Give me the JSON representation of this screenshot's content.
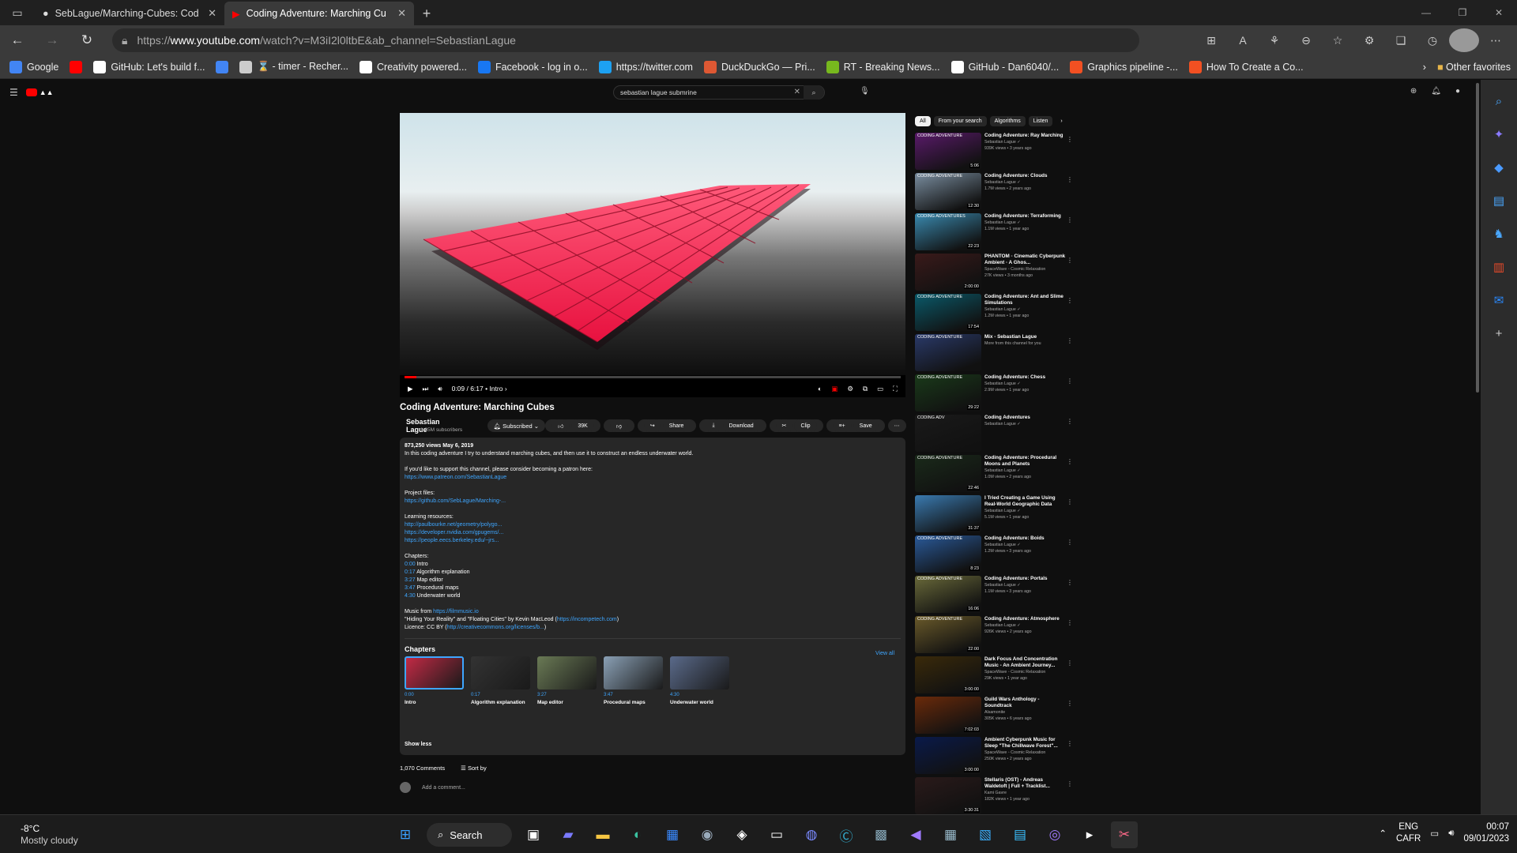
{
  "browser": {
    "tabs": [
      {
        "title": "SebLague/Marching-Cubes: Cod",
        "icon": "github-icon",
        "active": false
      },
      {
        "title": "Coding Adventure: Marching Cu",
        "icon": "youtube-icon",
        "active": true
      }
    ],
    "url_prefix": "https://",
    "url_domain": "www.youtube.com",
    "url_path": "/watch?v=M3iI2l0ltbE&ab_channel=SebastianLague",
    "favorites": [
      {
        "label": "Google",
        "icon": "google-icon",
        "color": "#4285f4"
      },
      {
        "label": "",
        "icon": "youtube-icon",
        "color": "#ff0000"
      },
      {
        "label": "GitHub: Let's build f...",
        "icon": "github-icon",
        "color": "#ffffff"
      },
      {
        "label": "",
        "icon": "google-icon",
        "color": "#4285f4"
      },
      {
        "label": "⌛ - timer - Recher...",
        "icon": "hourglass-icon",
        "color": "#cccccc"
      },
      {
        "label": "Creativity powered...",
        "icon": "patreon-icon",
        "color": "#ffffff"
      },
      {
        "label": "Facebook - log in o...",
        "icon": "facebook-icon",
        "color": "#1877f2"
      },
      {
        "label": "https://twitter.com",
        "icon": "twitter-icon",
        "color": "#1da1f2"
      },
      {
        "label": "DuckDuckGo — Pri...",
        "icon": "duckduckgo-icon",
        "color": "#de5833"
      },
      {
        "label": "RT - Breaking News...",
        "icon": "rt-icon",
        "color": "#77b81e"
      },
      {
        "label": "GitHub - Dan6040/...",
        "icon": "github-icon",
        "color": "#ffffff"
      },
      {
        "label": "Graphics pipeline -...",
        "icon": "microsoft-icon",
        "color": "#f25022"
      },
      {
        "label": "How To Create a Co...",
        "icon": "microsoft-icon",
        "color": "#f25022"
      }
    ],
    "other_favorites": "Other favorites"
  },
  "youtube": {
    "search_query": "sebastian lague submrine",
    "video": {
      "title": "Coding Adventure: Marching Cubes",
      "time": "0:09 / 6:17",
      "chapter": "• Intro",
      "progress": 0.024,
      "channel": "Sebastian Lague",
      "subscribers": "1.35M subscribers",
      "subscribe_label": "Subscribed",
      "likes": "39K",
      "share": "Share",
      "download": "Download",
      "clip": "Clip",
      "save": "Save"
    },
    "description": {
      "stats": "873,250 views  May 6, 2019",
      "lines": [
        {
          "text": "In this coding adventure I try to understand marching cubes, and then use it to construct an endless underwater world.",
          "link": false
        },
        {
          "text": "",
          "link": false
        },
        {
          "text": "If you'd like to support this channel, please consider becoming a patron here:",
          "link": false
        },
        {
          "text": "https://www.patreon.com/SebastianLague",
          "link": true
        },
        {
          "text": "",
          "link": false
        },
        {
          "text": "Project files:",
          "link": false
        },
        {
          "text": "https://github.com/SebLague/Marching-...",
          "link": true
        },
        {
          "text": "",
          "link": false
        },
        {
          "text": "Learning resources:",
          "link": false
        },
        {
          "text": "http://paulbourke.net/geometry/polygo...",
          "link": true
        },
        {
          "text": "https://developer.nvidia.com/gpugems/...",
          "link": true
        },
        {
          "text": "https://people.eecs.berkeley.edu/~jrs...",
          "link": true
        },
        {
          "text": "",
          "link": false
        },
        {
          "text": "Chapters:",
          "link": false
        }
      ],
      "chapter_lines": [
        {
          "time": "0:00",
          "name": "Intro"
        },
        {
          "time": "0:17",
          "name": "Algorithm explanation"
        },
        {
          "time": "3:27",
          "name": "Map editor"
        },
        {
          "time": "3:47",
          "name": "Procedural maps"
        },
        {
          "time": "4:30",
          "name": "Underwater world"
        }
      ],
      "music_prefix": "Music from ",
      "music_link": "https://filmmusic.io",
      "music_credit": "\"Hiding Your Reality\" and \"Floating Cities\" by Kevin MacLeod (",
      "music_credit_link": "https://incompetech.com",
      "music_credit_end": ")",
      "licence_prefix": "Licence: CC BY (",
      "licence_link": "http://creativecommons.org/licenses/b...",
      "licence_end": ")",
      "chapters_title": "Chapters",
      "view_all": "View all",
      "show_less": "Show less"
    },
    "chapter_cards": [
      {
        "time": "0:00",
        "name": "Intro",
        "color": "#c22a45"
      },
      {
        "time": "0:17",
        "name": "Algorithm explanation",
        "color": "#333333"
      },
      {
        "time": "3:27",
        "name": "Map editor",
        "color": "#6a7a55"
      },
      {
        "time": "3:47",
        "name": "Procedural maps",
        "color": "#8aa0b5"
      },
      {
        "time": "4:30",
        "name": "Underwater world",
        "color": "#5a6a8a"
      }
    ],
    "comments": {
      "count": "1,070 Comments",
      "sort": "Sort by",
      "add": "Add a comment..."
    },
    "filters": [
      "All",
      "From your search",
      "Algorithms",
      "Listen"
    ],
    "sidebar": [
      {
        "title": "Coding Adventure: Ray Marching",
        "channel": "Sebastian Lague ✓",
        "meta": "939K views • 3 years ago",
        "duration": "5:06",
        "color": "#5a1a6a",
        "top": "CODING ADVENTURE"
      },
      {
        "title": "Coding Adventure: Clouds",
        "channel": "Sebastian Lague ✓",
        "meta": "1.7M views • 2 years ago",
        "duration": "12:30",
        "color": "#7a8ea0",
        "top": "CODING ADVENTURE"
      },
      {
        "title": "Coding Adventure: Terraforming",
        "channel": "Sebastian Lague ✓",
        "meta": "1.1M views • 1 year ago",
        "duration": "22:23",
        "color": "#3a8ab0",
        "top": "CODING ADVENTURES"
      },
      {
        "title": "PHANTOM ◦ Cinematic Cyberpunk Ambient ◦ A Ghos...",
        "channel": "SpaceWave ◦ Cosmic Relaxation",
        "meta": "27K views • 3 months ago",
        "duration": "2:00:00",
        "color": "#3a1a1a",
        "top": ""
      },
      {
        "title": "Coding Adventure: Ant and Slime Simulations",
        "channel": "Sebastian Lague ✓",
        "meta": "1.2M views • 1 year ago",
        "duration": "17:54",
        "color": "#0a5a6a",
        "top": "CODING ADVENTURE"
      },
      {
        "title": "Mix - Sebastian Lague",
        "channel": "More from this channel for you",
        "meta": "",
        "duration": "",
        "color": "#2a3a6a",
        "top": "CODING ADVENTURE"
      },
      {
        "title": "Coding Adventure: Chess",
        "channel": "Sebastian Lague ✓",
        "meta": "2.9M views • 1 year ago",
        "duration": "29:22",
        "color": "#1a3a1a",
        "top": "CODING ADVENTURE"
      },
      {
        "title": "Coding Adventures",
        "channel": "Sebastian Lague ✓",
        "meta": "",
        "duration": "",
        "color": "#1a1a1a",
        "top": "CODING ADV"
      },
      {
        "title": "Coding Adventure: Procedural Moons and Planets",
        "channel": "Sebastian Lague ✓",
        "meta": "1.0M views • 2 years ago",
        "duration": "22:46",
        "color": "#1a2a1a",
        "top": "CODING ADVENTURE"
      },
      {
        "title": "I Tried Creating a Game Using Real-World Geographic Data",
        "channel": "Sebastian Lague ✓",
        "meta": "5.1M views • 1 year ago",
        "duration": "31:37",
        "color": "#3a7ab0",
        "top": ""
      },
      {
        "title": "Coding Adventure: Boids",
        "channel": "Sebastian Lague ✓",
        "meta": "1.2M views • 3 years ago",
        "duration": "8:23",
        "color": "#2a5a9a",
        "top": "CODING ADVENTURE"
      },
      {
        "title": "Coding Adventure: Portals",
        "channel": "Sebastian Lague ✓",
        "meta": "1.1M views • 3 years ago",
        "duration": "16:06",
        "color": "#6a6a3a",
        "top": "CODING ADVENTURE"
      },
      {
        "title": "Coding Adventure: Atmosphere",
        "channel": "Sebastian Lague ✓",
        "meta": "926K views • 2 years ago",
        "duration": "22:00",
        "color": "#6a5a2a",
        "top": "CODING ADVENTURE"
      },
      {
        "title": "Dark Focus And Concentration Music - An Ambient Journey...",
        "channel": "SpaceWave ◦ Cosmic Relaxation",
        "meta": "29K views • 1 year ago",
        "duration": "3:00:00",
        "color": "#3a2a0a",
        "top": ""
      },
      {
        "title": "Guild Wars Anthology - Soundtrack",
        "channel": "Alsamonite",
        "meta": "305K views • 6 years ago",
        "duration": "7:02:03",
        "color": "#6a2a0a",
        "top": ""
      },
      {
        "title": "Ambient Cyberpunk Music for Sleep \"The Chillwave Forest\"...",
        "channel": "SpaceWave ◦ Cosmic Relaxation",
        "meta": "250K views • 2 years ago",
        "duration": "3:00:00",
        "color": "#0a1a4a",
        "top": ""
      },
      {
        "title": "Stellaris (OST) - Andreas Waldetoft | Full + Tracklist...",
        "channel": "Kami Gavre",
        "meta": "182K views • 1 year ago",
        "duration": "3:30:31",
        "color": "#2a1a1a",
        "top": ""
      }
    ]
  },
  "taskbar": {
    "temp": "-8°C",
    "weather": "Mostly cloudy",
    "search": "Search",
    "lang1": "ENG",
    "lang2": "CAFR",
    "time": "00:07",
    "date": "09/01/2023"
  }
}
